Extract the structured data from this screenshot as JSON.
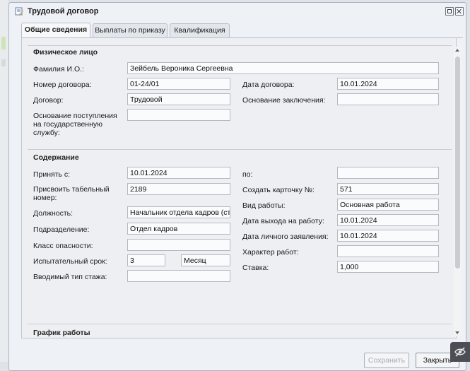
{
  "window": {
    "title": "Трудовой договор"
  },
  "tabs": [
    "Общие сведения",
    "Выплаты по приказу",
    "Квалификация"
  ],
  "section_person": {
    "title": "Физическое лицо",
    "fio_label": "Фамилия И.О.:",
    "fio_value": "Зейбель Вероника Сергеевна",
    "contract_no_label": "Номер договора:",
    "contract_no_value": "01-24/01",
    "contract_date_label": "Дата договора:",
    "contract_date_value": "10.01.2024",
    "contract_label": "Договор:",
    "contract_value": "Трудовой",
    "basis_label": "Основание заключения:",
    "basis_value": "",
    "civil_basis_label": "Основание поступления на государственную службу:",
    "civil_basis_value": ""
  },
  "section_content": {
    "title": "Содержание",
    "accept_from_label": "Принять с:",
    "accept_from_value": "10.01.2024",
    "to_label": "по:",
    "to_value": "",
    "tab_no_label": "Присвоить табельный номер:",
    "tab_no_value": "2189",
    "card_no_label": "Создать карточку №:",
    "card_no_value": "571",
    "work_type_label": "Вид работы:",
    "work_type_value": "Основная работа",
    "position_label": "Должность:",
    "position_value": "Начальник отдела кадров (ст",
    "start_date_label": "Дата выхода на работу:",
    "start_date_value": "10.01.2024",
    "department_label": "Подразделение:",
    "department_value": "Отдел кадров",
    "application_date_label": "Дата личного заявления:",
    "application_date_value": "10.01.2024",
    "danger_class_label": "Класс опасности:",
    "danger_class_value": "",
    "work_nature_label": "Характер работ:",
    "work_nature_value": "",
    "probation_label": "Испытательный срок:",
    "probation_value": "3",
    "probation_unit": "Месяц",
    "rate_label": "Ставка:",
    "rate_value": "1,000",
    "seniority_label": "Вводимый тип стажа:",
    "seniority_value": ""
  },
  "section_schedule": {
    "title": "График работы"
  },
  "buttons": {
    "save": "Сохранить",
    "close": "Закрыть"
  },
  "icons": {
    "window": "document-edit-icon",
    "corner": "crossed-eye-icon"
  }
}
